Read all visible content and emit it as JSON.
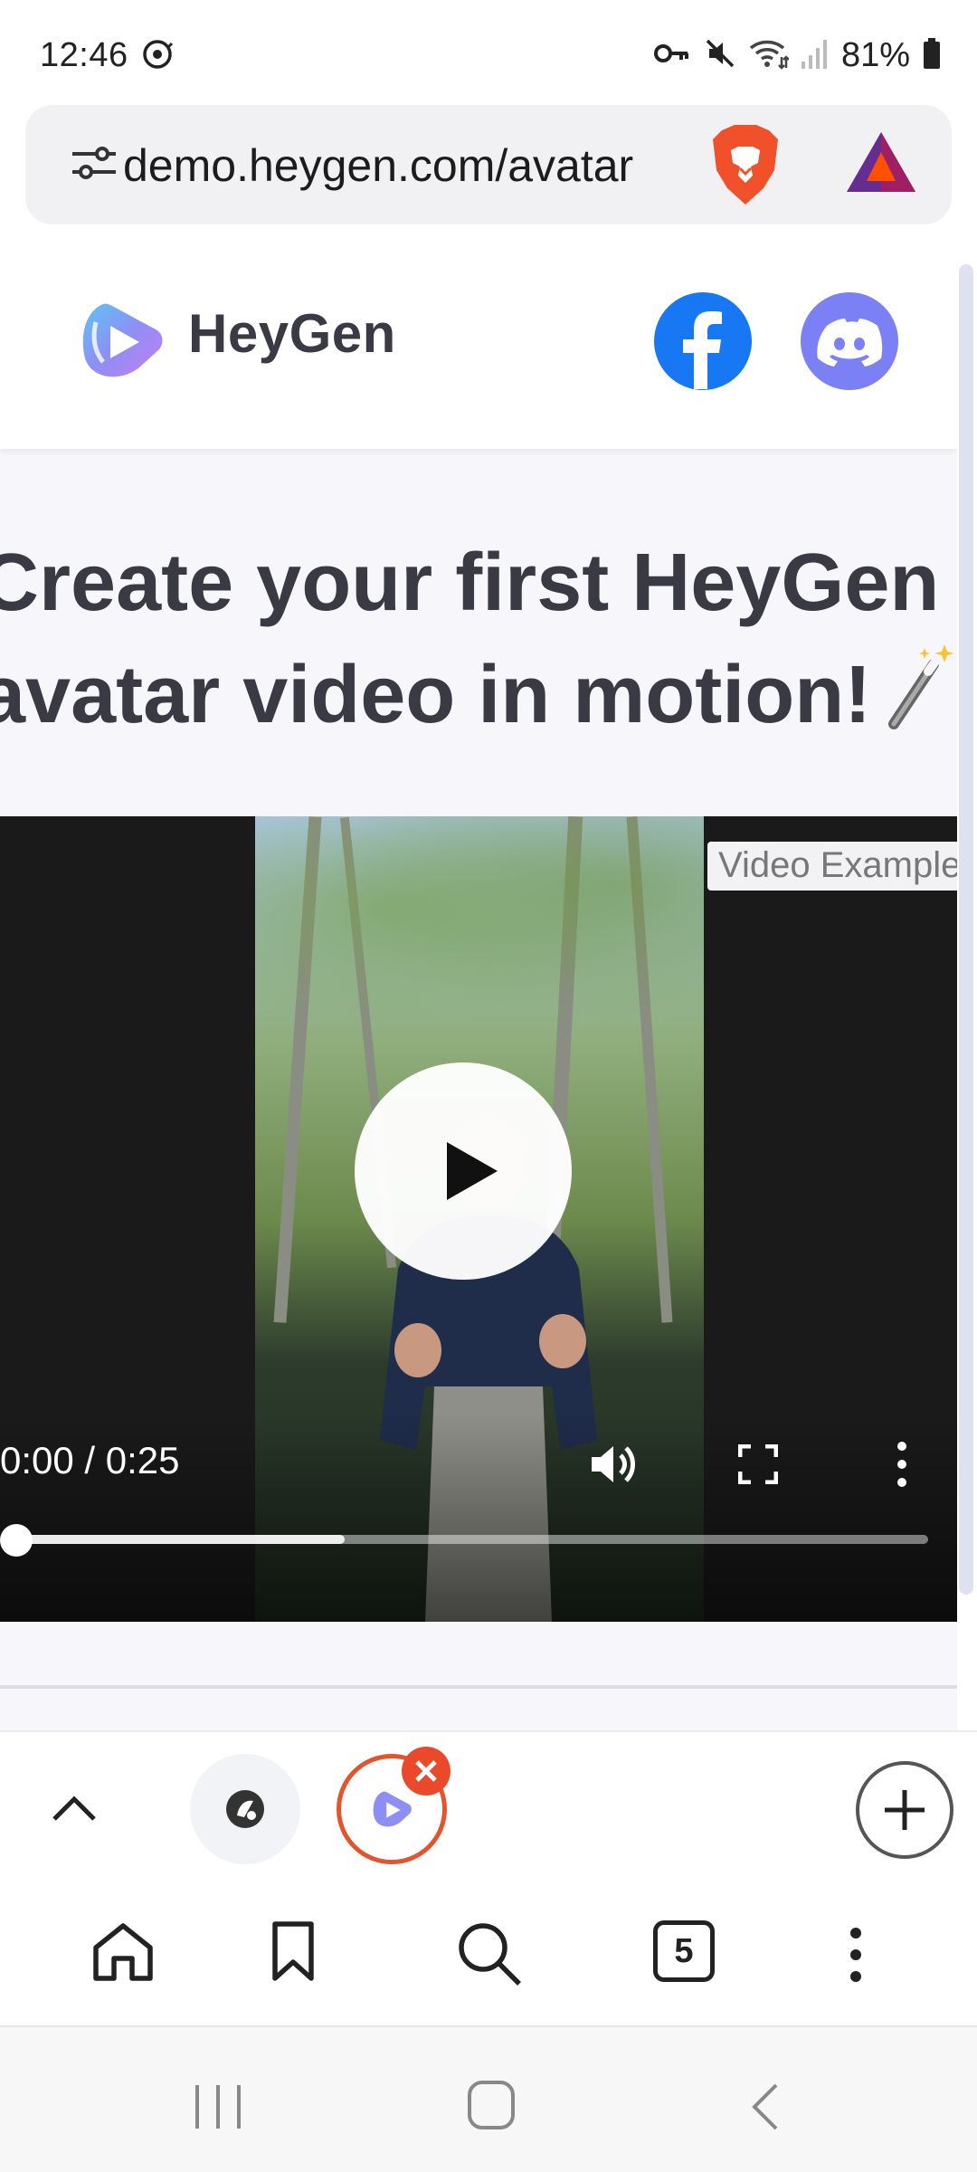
{
  "status_bar": {
    "time": "12:46",
    "battery": "81%",
    "icons": [
      "sync-icon",
      "vpn-key-icon",
      "mute-icon",
      "wifi-icon",
      "signal-icon",
      "battery-icon"
    ]
  },
  "address_bar": {
    "url": "demo.heygen.com/avatar",
    "icons": [
      "site-settings-icon",
      "brave-shields-icon",
      "brave-rewards-icon"
    ]
  },
  "site": {
    "name": "HeyGen",
    "hero_title_line1": "Create your first HeyGen",
    "hero_title_line2": "avatar video in motion!",
    "social": [
      "facebook-icon",
      "discord-icon"
    ],
    "colors": {
      "facebook": "#1877f2",
      "discord": "#7b80f4",
      "heading": "#3a3a44"
    }
  },
  "video": {
    "badge": "Video Example",
    "time": "0:00 / 0:25",
    "progress": 0,
    "buffered": 0.36
  },
  "tab_strip": {
    "open_tabs": 2,
    "active_tab_accent": "#e2542e"
  },
  "toolbar": {
    "tab_count": "5"
  }
}
